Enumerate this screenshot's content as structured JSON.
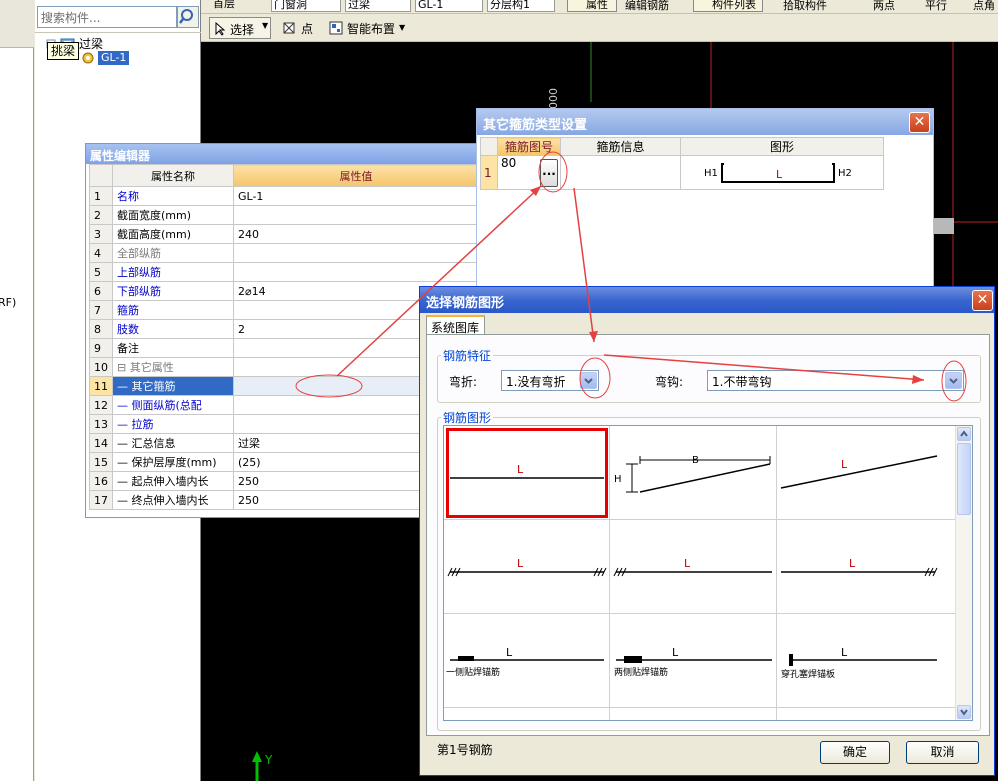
{
  "toolbar": {
    "top_items": [
      "首层",
      "门窗洞",
      "过梁",
      "GL-1",
      "分层构1"
    ],
    "attr_label": "属性",
    "edit_rebar_label": "编辑钢筋",
    "component_list_label": "构件列表",
    "pick_component_label": "拾取构件",
    "two_points_label": "两点",
    "parallel_label": "平行",
    "point_angle_label": "点角",
    "select_label": "选择",
    "point_label": "点",
    "smart_layout_label": "智能布置"
  },
  "left_panel": {
    "cut_text": "RF)"
  },
  "tree": {
    "search_placeholder": "搜索构件...",
    "root_label": "过梁",
    "tooltip": "挑梁",
    "child_label": "GL-1"
  },
  "property_editor": {
    "title": "属性编辑器",
    "col_name": "属性名称",
    "col_value": "属性值",
    "rows": [
      {
        "num": "1",
        "name": "名称",
        "value": "GL-1",
        "style": "blue"
      },
      {
        "num": "2",
        "name": "截面宽度(mm)",
        "value": "",
        "style": "black"
      },
      {
        "num": "3",
        "name": "截面高度(mm)",
        "value": "240",
        "style": "black"
      },
      {
        "num": "4",
        "name": "全部纵筋",
        "value": "",
        "style": "gray"
      },
      {
        "num": "5",
        "name": "上部纵筋",
        "value": "",
        "style": "blue"
      },
      {
        "num": "6",
        "name": "下部纵筋",
        "value": "2⌀14",
        "style": "blue"
      },
      {
        "num": "7",
        "name": "箍筋",
        "value": "",
        "style": "blue"
      },
      {
        "num": "8",
        "name": "肢数",
        "value": "2",
        "style": "blue"
      },
      {
        "num": "9",
        "name": "备注",
        "value": "",
        "style": "black"
      },
      {
        "num": "10",
        "name": "⊟ 其它属性",
        "value": "",
        "style": "gray"
      },
      {
        "num": "11",
        "name": "— 其它箍筋",
        "value": "",
        "style": "sel"
      },
      {
        "num": "12",
        "name": "— 侧面纵筋(总配",
        "value": "",
        "style": "blue"
      },
      {
        "num": "13",
        "name": "— 拉筋",
        "value": "",
        "style": "blue"
      },
      {
        "num": "14",
        "name": "— 汇总信息",
        "value": "过梁",
        "style": "black"
      },
      {
        "num": "15",
        "name": "— 保护层厚度(mm)",
        "value": "(25)",
        "style": "black"
      },
      {
        "num": "16",
        "name": "— 起点伸入墙内长",
        "value": "250",
        "style": "black"
      },
      {
        "num": "17",
        "name": "— 终点伸入墙内长",
        "value": "250",
        "style": "black"
      }
    ]
  },
  "stirrup_dialog": {
    "title": "其它箍筋类型设置",
    "col_shape_no": "箍筋图号",
    "col_info": "箍筋信息",
    "col_figure": "图形",
    "row": {
      "num": "1",
      "shape_no": "80",
      "ellipsis": "...",
      "h1": "H1",
      "h2": "H2",
      "l": "L"
    }
  },
  "shape_dialog": {
    "title": "选择钢筋图形",
    "tab_label": "系统图库",
    "feature_group": "钢筋特征",
    "bend_label": "弯折:",
    "bend_value": "1.没有弯折",
    "hook_label": "弯钩:",
    "hook_value": "1.不带弯钩",
    "shape_group": "钢筋图形",
    "shapes": [
      {
        "caption": "",
        "l": "L"
      },
      {
        "caption": "",
        "l": "",
        "b": "B",
        "h": "H"
      },
      {
        "caption": "",
        "l": "L"
      },
      {
        "caption": "",
        "l": "L"
      },
      {
        "caption": "",
        "l": "L"
      },
      {
        "caption": "",
        "l": "L"
      },
      {
        "caption": "一侧贴焊锚筋",
        "l": "L"
      },
      {
        "caption": "两侧贴焊锚筋",
        "l": "L"
      },
      {
        "caption": "穿孔塞焊锚板",
        "l": "L"
      }
    ],
    "status_text": "第1号钢筋",
    "ok_label": "确定",
    "cancel_label": "取消"
  },
  "canvas": {
    "axis_label": "Y"
  },
  "colors": {
    "selection_red": "#e80000",
    "annotation_red": "#e64040",
    "title_blue": "#0a3fd4"
  }
}
